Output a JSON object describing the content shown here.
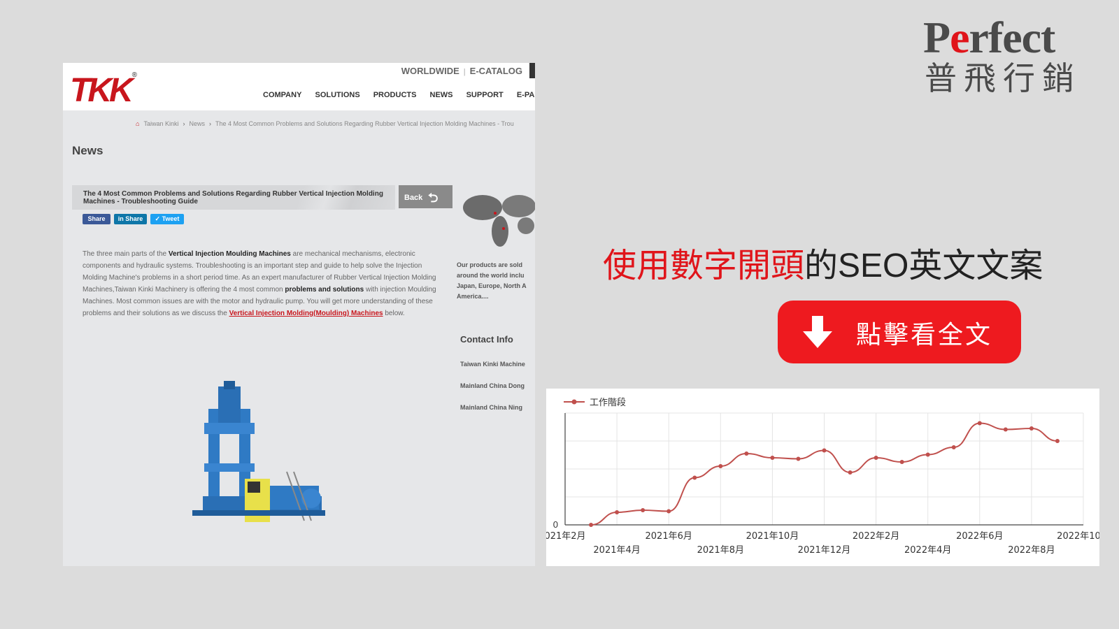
{
  "site": {
    "logo": "TKK",
    "top_links": [
      "WORLDWIDE",
      "E-CATALOG"
    ],
    "nav": [
      "COMPANY",
      "SOLUTIONS",
      "PRODUCTS",
      "NEWS",
      "SUPPORT",
      "E-PAPER"
    ],
    "breadcrumb": [
      "Taiwan Kinki",
      "News",
      "The 4 Most Common Problems and Solutions Regarding Rubber Vertical Injection Molding Machines - Trou"
    ],
    "section_heading": "News",
    "article_title": "The 4 Most Common Problems and Solutions Regarding Rubber Vertical Injection Molding Machines - Troubleshooting Guide",
    "back_label": "Back",
    "share_buttons": [
      "Share",
      "Share",
      "Tweet"
    ],
    "article": {
      "p1": "The three main parts of the ",
      "b1": "Vertical Injection Moulding Machines",
      "p2": " are mechanical mechanisms, electronic components and hydraulic systems. Troubleshooting is an important step and guide to help solve the Injection Molding Machine's problems in a short period time. As an expert manufacturer of Rubber Vertical Injection Molding Machines,Taiwan Kinki Machinery is offering the 4 most common ",
      "b2": "problems and solutions",
      "p3": " with injection Moulding Machines. Most common issues are with the motor and hydraulic pump. You will get more understanding of these problems and their solutions as we discuss the ",
      "link": "Vertical Injection Molding(Moulding) Machines",
      "p4": " below."
    },
    "products_text": [
      "Our products are sold",
      "around the world inclu",
      "Japan, Europe, North A",
      "America...."
    ],
    "contact_title": "Contact Info",
    "contact_items": [
      "Taiwan Kinki Machine",
      "Mainland China Dong",
      "Mainland China Ning"
    ]
  },
  "brand": {
    "en_pre": "P",
    "en_mid": "e",
    "en_post": "rfect",
    "zh": "普飛行銷"
  },
  "headline": {
    "red": "使用數字開頭",
    "rest": "的SEO英文文案"
  },
  "cta": {
    "label": "點擊看全文",
    "icon": "arrow-down-icon"
  },
  "colors": {
    "accent_red": "#e0141a",
    "site_red": "#c8161d",
    "series": "#c0504d"
  },
  "chart_data": {
    "type": "line",
    "series": [
      {
        "name": "工作階段",
        "x": [
          "2021-03",
          "2021-04",
          "2021-05",
          "2021-06",
          "2021-07",
          "2021-08",
          "2021-09",
          "2021-10",
          "2021-11",
          "2021-12",
          "2022-01",
          "2022-02",
          "2022-03",
          "2022-04",
          "2022-05",
          "2022-06",
          "2022-07",
          "2022-08",
          "2022-09",
          "2022-10"
        ],
        "values": [
          0,
          12,
          14,
          13,
          45,
          56,
          68,
          64,
          63,
          71,
          50,
          64,
          60,
          67,
          74,
          97,
          91,
          92,
          80,
          null
        ]
      }
    ],
    "x_tick_labels_upper": [
      "021年2月",
      "2021年6月",
      "2021年10月",
      "2022年2月",
      "2022年6月",
      "2022年10月"
    ],
    "x_tick_labels_lower": [
      "2021年4月",
      "2021年8月",
      "2021年12月",
      "2022年4月",
      "2022年8月"
    ],
    "y_tick_labels": [
      "0"
    ],
    "legend": "top-left",
    "grid": true
  }
}
